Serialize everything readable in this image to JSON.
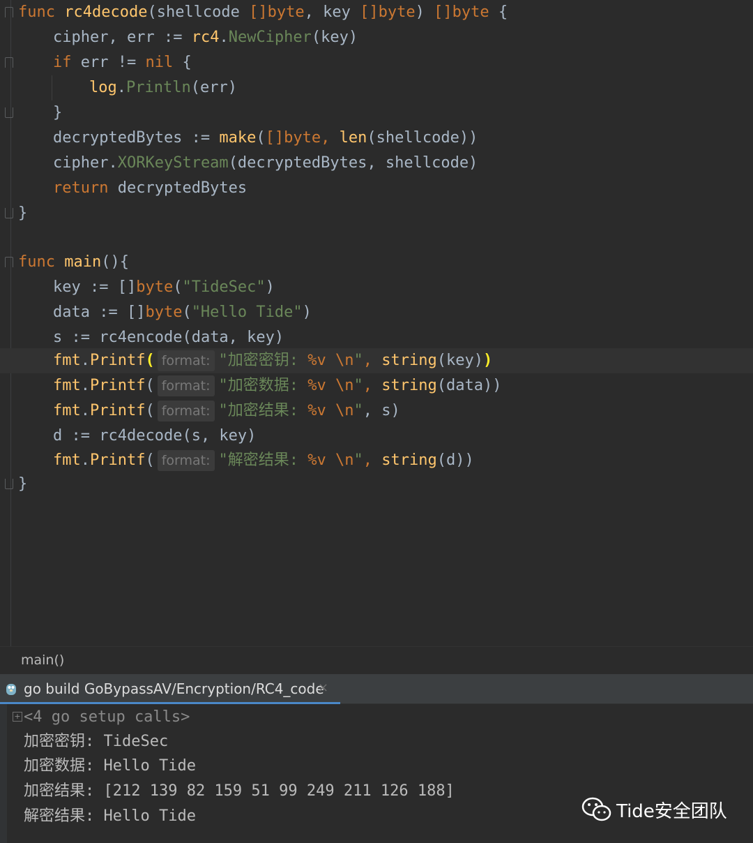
{
  "editor": {
    "lines": [
      [
        "func",
        " ",
        "rc4decode",
        "(shellcode ",
        "[]byte",
        ", key ",
        "[]byte",
        ") ",
        "[]byte",
        " {"
      ],
      [
        "cipher",
        ", err := ",
        "rc4",
        ".",
        "NewCipher",
        "(key)"
      ],
      [
        "if",
        " err != ",
        "nil",
        " {"
      ],
      [
        "log",
        ".",
        "Println",
        "(err)"
      ],
      [
        "}"
      ],
      [
        "decryptedBytes := ",
        "make",
        "(",
        "[]byte",
        ", ",
        "len",
        "(shellcode))"
      ],
      [
        "cipher",
        ".",
        "XORKeyStream",
        "(decryptedBytes, shellcode)"
      ],
      [
        "return",
        " decryptedBytes"
      ],
      [
        "}"
      ],
      [],
      [
        "func",
        " ",
        "main",
        "(){"
      ],
      [
        "key := []",
        "byte",
        "(",
        "\"TideSec\"",
        ")"
      ],
      [
        "data := []",
        "byte",
        "(",
        "\"Hello Tide\"",
        ")"
      ],
      [
        "s := ",
        "rc4encode",
        "(data, key)"
      ],
      [
        "fmt",
        ".",
        "Printf",
        "(",
        "format:",
        "\"加密密钥: ",
        "%v",
        " ",
        "\\n",
        "\"",
        ", ",
        "string",
        "(key)",
        ")"
      ],
      [
        "fmt",
        ".",
        "Printf",
        "(",
        "format:",
        "\"加密数据: ",
        "%v",
        " ",
        "\\n",
        "\"",
        ", ",
        "string",
        "(data))"
      ],
      [
        "fmt",
        ".",
        "Printf",
        "(",
        "format:",
        "\"加密结果: ",
        "%v",
        " ",
        "\\n",
        "\"",
        ", s)"
      ],
      [
        "d := ",
        "rc4decode",
        "(s, key)"
      ],
      [
        "fmt",
        ".",
        "Printf",
        "(",
        "format:",
        "\"解密结果: ",
        "%v",
        " ",
        "\\n",
        "\"",
        ", ",
        "string",
        "(d))"
      ],
      [
        "}"
      ]
    ]
  },
  "breadcrumb": "main()",
  "run": {
    "title": "go build GoBypassAV/Encryption/RC4_code",
    "close": "×"
  },
  "console": {
    "lines": [
      "<4 go setup calls>",
      "加密密钥: TideSec",
      "加密数据: Hello Tide",
      "加密结果: [212 139 82 159 51 99 249 211 126 188]",
      "解密结果: Hello Tide"
    ]
  },
  "watermark": "Tide安全团队",
  "colors": {
    "background": "#2b2b2b",
    "keyword": "#cc7832",
    "function": "#ffc66d",
    "string": "#6a8759",
    "text": "#a9b7c6",
    "accent": "#4a88c7"
  }
}
